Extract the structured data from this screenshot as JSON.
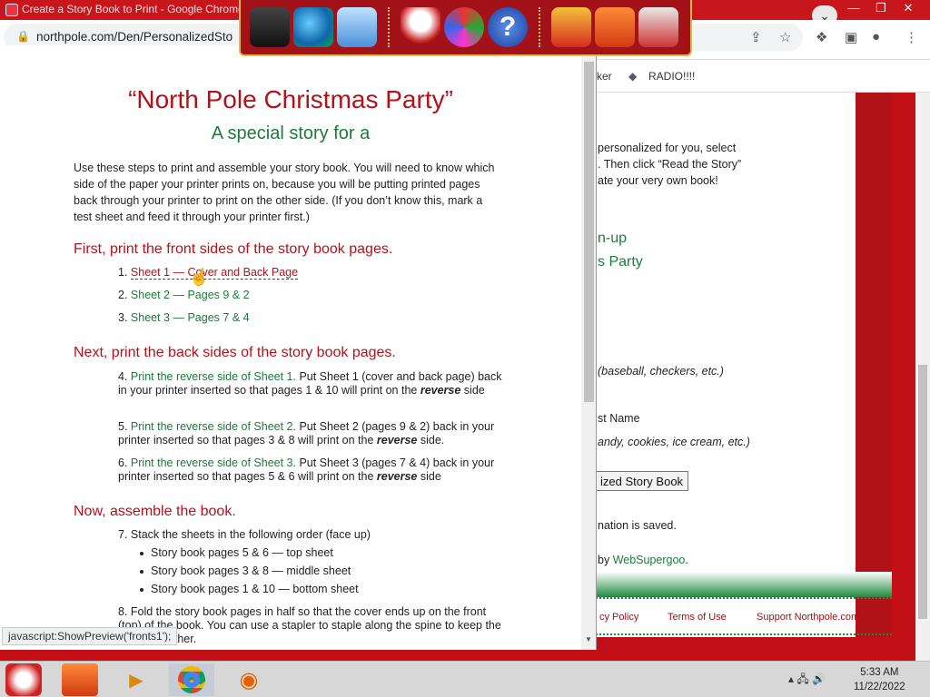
{
  "browser": {
    "tab_title": "Create a Story Book to Print - Google Chrome",
    "url": "northpole.com/Den/PersonalizedSto",
    "bookmarks": [
      "ker",
      "RADIO!!!!"
    ]
  },
  "background_page": {
    "lines": [
      "personalized for you, select",
      ". Then click “Read the Story”",
      "ate your very own book!",
      "n-up",
      "s Party",
      "(baseball, checkers, etc.)",
      "st Name",
      "andy, cookies, ice cream, etc.)",
      "nation is saved.",
      "by",
      "WebSupergoo",
      "."
    ],
    "button": "ized Story Book",
    "footer_links": [
      "cy Policy",
      "Terms of Use",
      "Support Northpole.com"
    ]
  },
  "popup": {
    "title": "“North Pole Christmas Party”",
    "subtitle": "A special story for a",
    "intro": "Use these steps to print and assemble your story book. You will need to know which side of the paper your printer prints on, because you will be putting printed pages back through your printer to print on the other side. (If you don’t know this, mark a test sheet and feed it through your printer first.)",
    "section1": "First, print the front sides of the story book pages.",
    "fronts": [
      {
        "num": "1.",
        "link": "Sheet 1 — Cover and Back Page"
      },
      {
        "num": "2.",
        "link": "Sheet 2 — Pages 9 & 2"
      },
      {
        "num": "3.",
        "link": "Sheet 3 — Pages 7 & 4"
      }
    ],
    "section2": "Next, print the back sides of the story book pages.",
    "backs": [
      {
        "num": "4.",
        "link": "Print the reverse side of Sheet 1.",
        "text": " Put Sheet 1 (cover and back page) back in your printer inserted so that pages 1 & 10 will print on the ",
        "em": "reverse",
        "tail": " side"
      },
      {
        "num": "5.",
        "link": "Print the reverse side of Sheet 2.",
        "text": " Put Sheet 2 (pages 9 & 2) back in your printer inserted so that pages 3 & 8 will print on the ",
        "em": "reverse",
        "tail": " side."
      },
      {
        "num": "6.",
        "link": "Print the reverse side of Sheet 3.",
        "text": " Put Sheet 3 (pages 7 & 4) back in your printer inserted so that pages 5 & 6 will print on the ",
        "em": "reverse",
        "tail": " side"
      }
    ],
    "section3": "Now, assemble the book.",
    "step7": "7. Stack the sheets in the following order (face up)",
    "stack": [
      "Story book pages 5 & 6 — top sheet",
      "Story book pages 3 & 8 — middle sheet",
      "Story book pages 1 & 10 — bottom sheet"
    ],
    "step8": "8. Fold the story book pages in half so that the cover ends up on the front (top) of the book. You can use a stapler to staple along the spine to keep the pages together.",
    "status": "javascript:ShowPreview('fronts1');"
  },
  "clock": {
    "time": "5:33 AM",
    "date": "11/22/2022"
  },
  "icons": [
    "computer-icon",
    "globe-icon",
    "control-panel-icon",
    "snowman-icon",
    "disk-icon",
    "help-icon",
    "gift-icon",
    "folder-icon",
    "recycle-bin-icon"
  ]
}
